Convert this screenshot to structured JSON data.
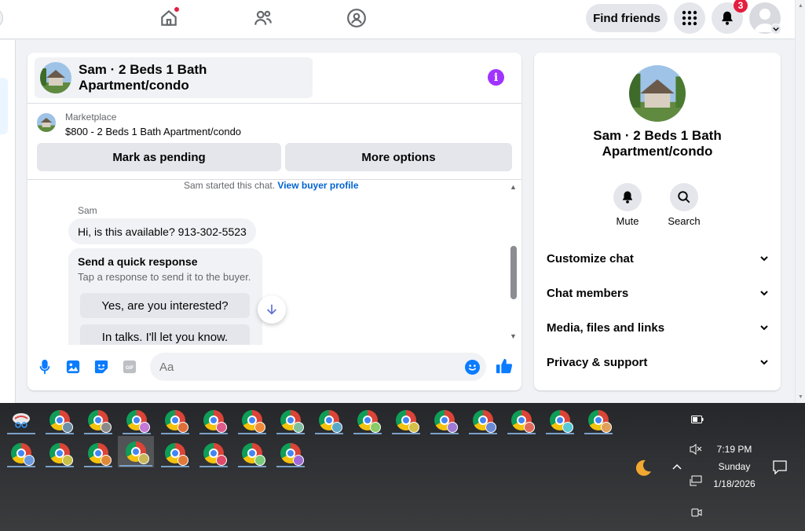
{
  "topnav": {
    "find_friends": "Find friends",
    "notification_count": "3"
  },
  "chat": {
    "title": "Sam · 2 Beds 1 Bath Apartment/condo",
    "marketplace_label": "Marketplace",
    "listing": "$800 - 2 Beds 1 Bath Apartment/condo",
    "mark_pending": "Mark as pending",
    "more_options": "More options",
    "started_text": "Sam started this chat.",
    "buyer_profile_link": "View buyer profile",
    "sender": "Sam",
    "message": "Hi, is this available? 913-302-5523",
    "quick_title": "Send a quick response",
    "quick_sub": "Tap a response to send it to the buyer.",
    "quick_options": [
      "Yes, are you interested?",
      "In talks. I'll let you know."
    ],
    "composer_placeholder": "Aa"
  },
  "info_panel": {
    "name": "Sam · 2 Beds 1 Bath Apartment/condo",
    "mute": "Mute",
    "search": "Search",
    "sections": [
      "Customize chat",
      "Chat members",
      "Media, files and links",
      "Privacy & support"
    ]
  },
  "taskbar": {
    "time": "7:19 PM",
    "day": "Sunday",
    "date": "1/18/2026"
  },
  "colors": {
    "accent": "#0a7cff",
    "info_purple": "#a033ff",
    "badge_red": "#e41e3f"
  }
}
